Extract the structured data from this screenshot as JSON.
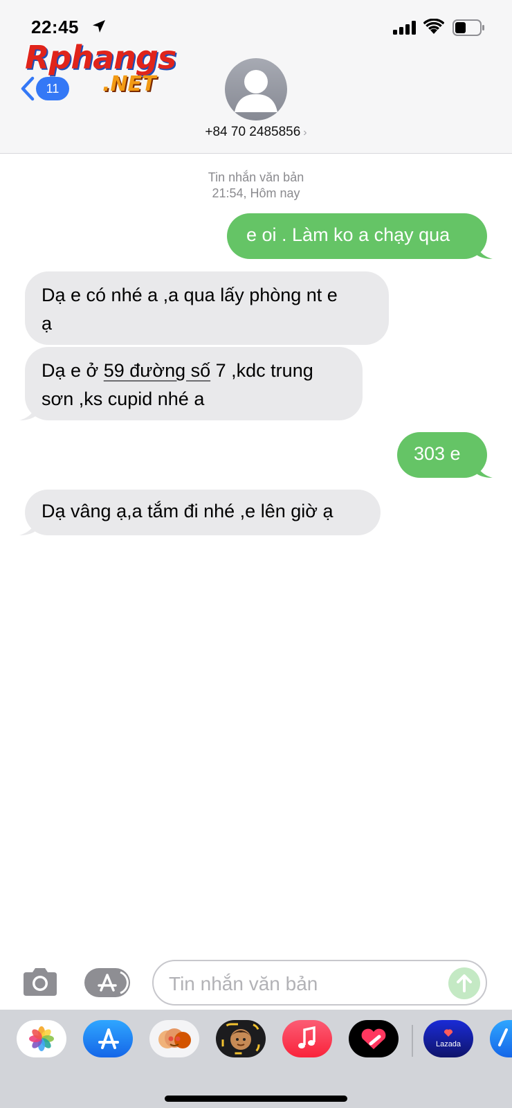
{
  "status_bar": {
    "time": "22:45"
  },
  "watermark": {
    "main": "Rphangs",
    "sub": ".NET"
  },
  "nav": {
    "unread_count": "11",
    "contact": "+84 70 2485856"
  },
  "thread": {
    "meta_service": "Tin nhắn văn bản",
    "meta_time": "21:54, Hôm nay",
    "messages": [
      {
        "from": "me",
        "text": "e oi . Làm ko a chạy qua"
      },
      {
        "from": "them",
        "line1": "Dạ e có nhé a ,a qua lấy phòng nt e",
        "line2": "ạ"
      },
      {
        "from": "them",
        "pre": "Dạ e ở ",
        "link": "59 đường số",
        "post": " 7 ,kdc trung",
        "line2": "sơn ,ks cupid nhé a"
      },
      {
        "from": "me",
        "text": "303 e"
      },
      {
        "from": "them",
        "text": "Dạ vâng ạ,a tắm đi nhé ,e lên giờ ạ"
      }
    ]
  },
  "compose": {
    "placeholder": "Tin nhắn văn bản"
  },
  "drawer": {
    "apps": [
      "photos-icon",
      "app-store-icon",
      "memoji-stickers-icon",
      "animoji-icon",
      "music-icon",
      "digital-touch-icon",
      "lazada-icon",
      "app-store-partial-icon"
    ],
    "lazada_label": "Lazada"
  },
  "colors": {
    "sent_bubble": "#65c466",
    "received_bubble": "#e9e9eb",
    "accent": "#3478f6"
  }
}
